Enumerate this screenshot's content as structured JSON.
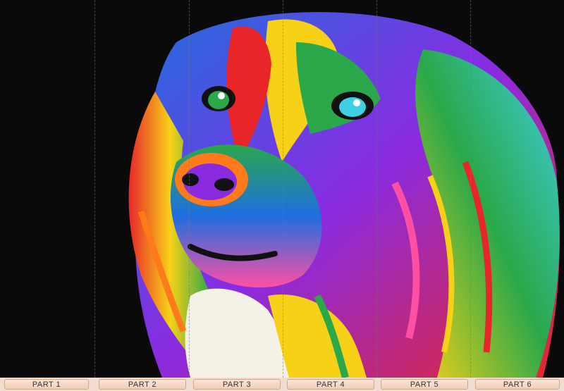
{
  "artwork": {
    "subject": "colorful-dog-portrait",
    "background_color": "#0a0a0a",
    "palette": [
      "#e8262a",
      "#f7d117",
      "#2aa84a",
      "#1e6fe0",
      "#8a2be2",
      "#ff7a1a",
      "#ff4fa3",
      "#3fd0e6"
    ]
  },
  "parts": [
    {
      "label": "PART 1"
    },
    {
      "label": "PART 2"
    },
    {
      "label": "PART 3"
    },
    {
      "label": "PART 4"
    },
    {
      "label": "PART 5"
    },
    {
      "label": "PART 6"
    }
  ],
  "colors": {
    "tab_background": "#f5d9c6",
    "tab_border": "#c9a98f",
    "footer_background": "#f2ddd0"
  }
}
